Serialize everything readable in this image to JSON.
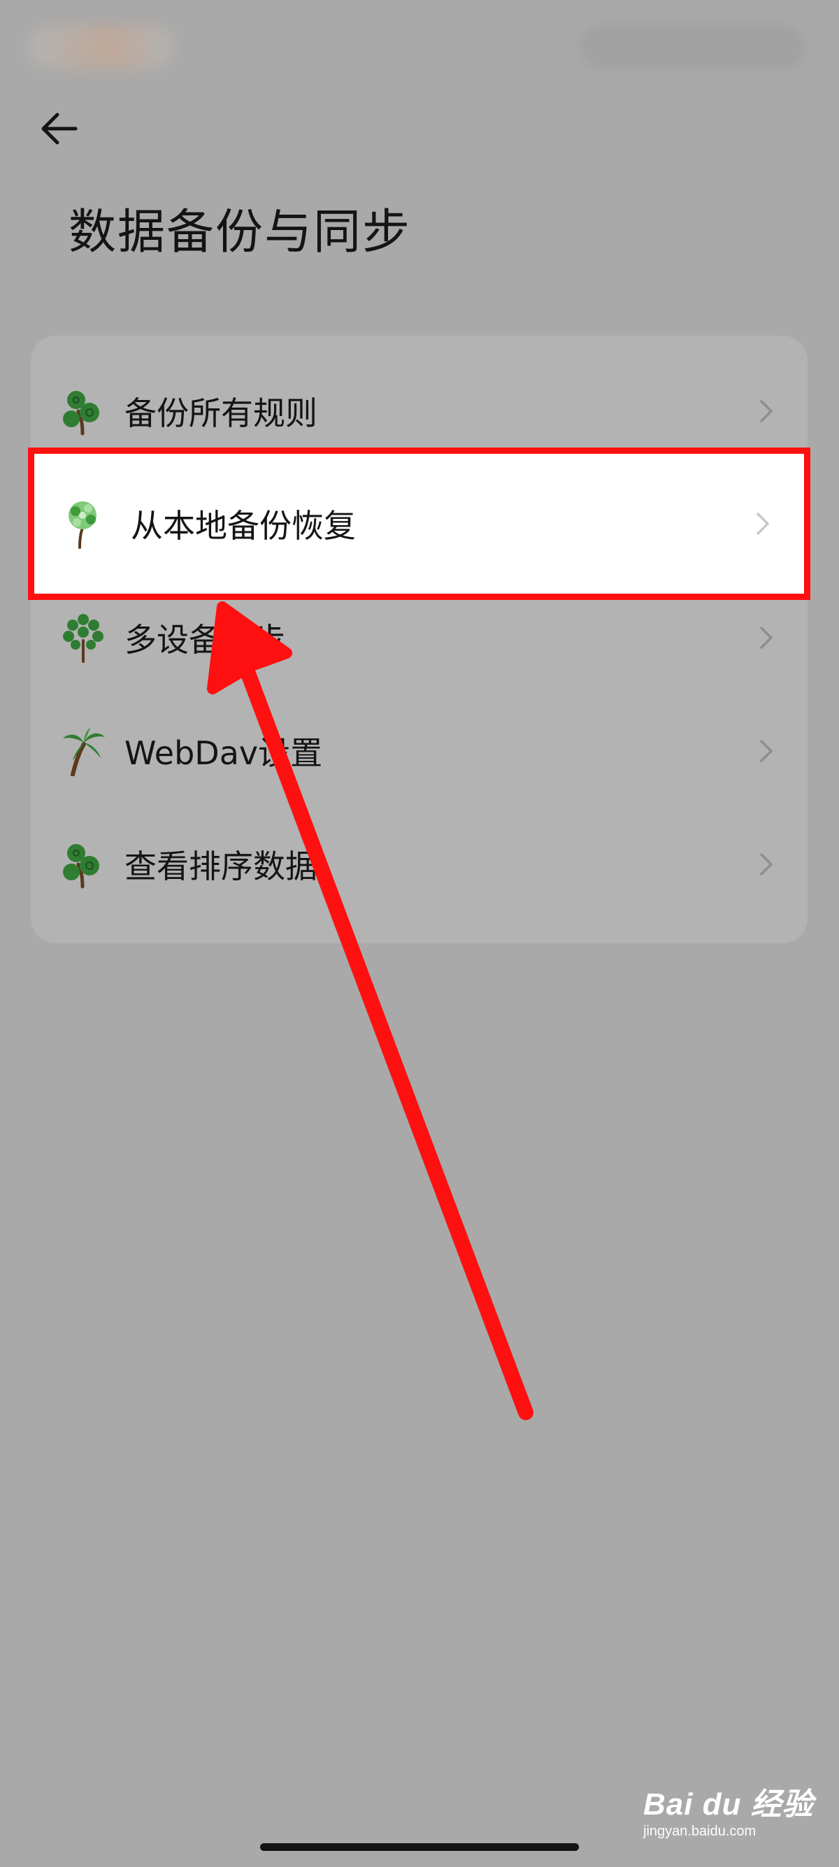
{
  "header": {
    "back_icon": "back-arrow-icon",
    "title": "数据备份与同步"
  },
  "menu": {
    "items": [
      {
        "label": "备份所有规则",
        "icon": "round-tree-icon",
        "highlighted": false
      },
      {
        "label": "从本地备份恢复",
        "icon": "leafy-tree-icon",
        "highlighted": true
      },
      {
        "label": "多设备同步",
        "icon": "dotted-tree-icon",
        "highlighted": false
      },
      {
        "label": "WebDav设置",
        "icon": "palm-tree-icon",
        "highlighted": false
      },
      {
        "label": "查看排序数据",
        "icon": "round-tree-icon",
        "highlighted": false
      }
    ]
  },
  "watermark": {
    "brand": "Bai du 经验",
    "domain": "jingyan.baidu.com"
  },
  "colors": {
    "background": "#a9a9a9",
    "card": "#b3b3b3",
    "highlight_border": "#ff1010",
    "annotation_arrow": "#ff1010",
    "tree_green": "#2f7d32",
    "trunk_brown": "#5b3a1e"
  }
}
